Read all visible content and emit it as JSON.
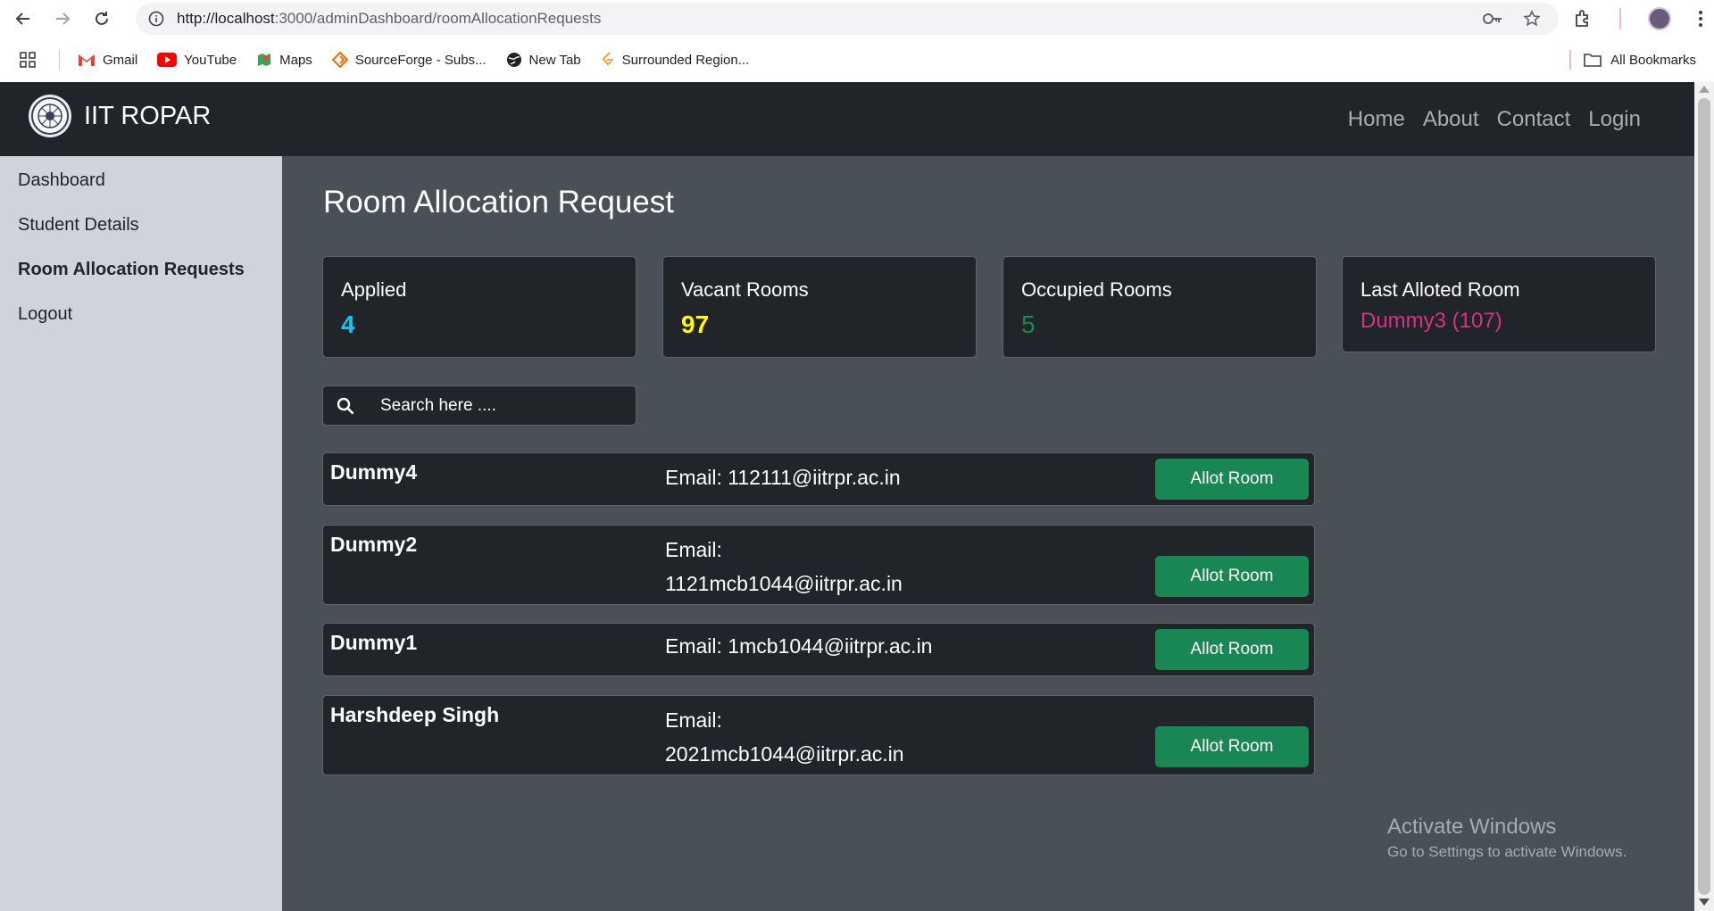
{
  "browser": {
    "url_host": "http://localhost",
    "url_path": ":3000/adminDashboard/roomAllocationRequests",
    "bookmarks": [
      {
        "label": "Gmail",
        "icon": "gmail-icon",
        "color": "#ea4335"
      },
      {
        "label": "YouTube",
        "icon": "youtube-icon",
        "color": "#ff0000"
      },
      {
        "label": "Maps",
        "icon": "maps-icon",
        "color": "#34a853"
      },
      {
        "label": "SourceForge - Subs...",
        "icon": "sourceforge-icon",
        "color": "#ff6600"
      },
      {
        "label": "New Tab",
        "icon": "globe-icon",
        "color": "#202124"
      },
      {
        "label": "Surrounded Region...",
        "icon": "leetcode-icon",
        "color": "#ffa116"
      }
    ],
    "all_bookmarks_label": "All Bookmarks"
  },
  "navbar": {
    "brand": "IIT ROPAR",
    "links": [
      "Home",
      "About",
      "Contact",
      "Login"
    ]
  },
  "sidebar": {
    "items": [
      {
        "label": "Dashboard",
        "active": false
      },
      {
        "label": "Student Details",
        "active": false
      },
      {
        "label": "Room Allocation Requests",
        "active": true
      },
      {
        "label": "Logout",
        "active": false
      }
    ]
  },
  "main": {
    "title": "Room Allocation Request",
    "stats": [
      {
        "label": "Applied",
        "value": "4",
        "color": "#0dcaf0"
      },
      {
        "label": "Vacant Rooms",
        "value": "97",
        "color": "#ffff00"
      },
      {
        "label": "Occupied Rooms",
        "value": "5",
        "color": "#198754"
      },
      {
        "label": "Last Alloted Room",
        "value": "Dummy3 (107)",
        "color": "#d63384"
      }
    ],
    "search": {
      "placeholder": "Search here ...."
    },
    "requests": [
      {
        "name": "Dummy4",
        "email_line1": "Email: 112111@iitrpr.ac.in",
        "email_line2": "",
        "button": "Allot Room"
      },
      {
        "name": "Dummy2",
        "email_line1": "Email:",
        "email_line2": "1121mcb1044@iitrpr.ac.in",
        "button": "Allot Room"
      },
      {
        "name": "Dummy1",
        "email_line1": "Email: 1mcb1044@iitrpr.ac.in",
        "email_line2": "",
        "button": "Allot Room"
      },
      {
        "name": "Harshdeep Singh",
        "email_line1": "Email:",
        "email_line2": "2021mcb1044@iitrpr.ac.in",
        "button": "Allot Room"
      }
    ]
  },
  "watermark": {
    "title": "Activate Windows",
    "subtitle": "Go to Settings to activate Windows."
  }
}
